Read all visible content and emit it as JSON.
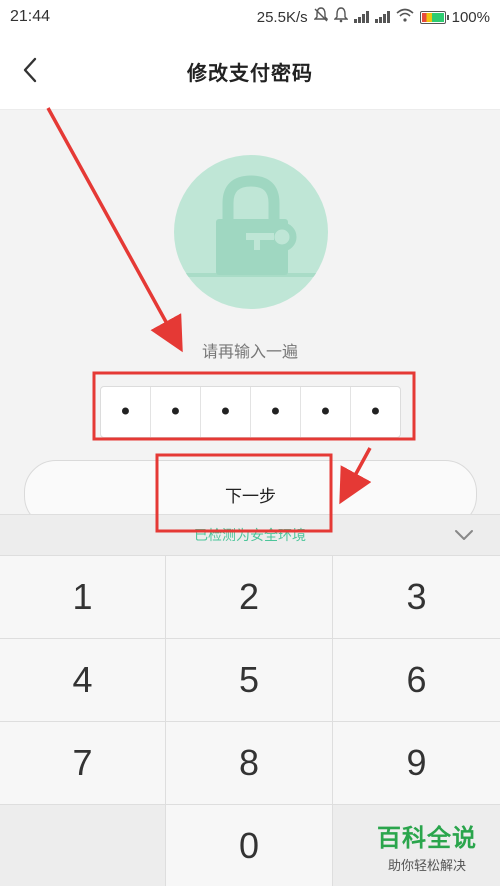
{
  "status_bar": {
    "time": "21:44",
    "network_speed": "25.5K/s",
    "battery": "100%",
    "icons": [
      "alarm-off-icon",
      "notification-bell-icon",
      "signal-icon",
      "signal-icon",
      "wifi-icon",
      "battery-icon"
    ]
  },
  "header": {
    "title": "修改支付密码",
    "back_icon": "chevron-left-icon"
  },
  "lock": {
    "icon": "lock-key-icon",
    "circle_color": "#bfe6d6",
    "icon_color": "#9fd7c1"
  },
  "password": {
    "instruction": "请再输入一遍",
    "digits": [
      "•",
      "•",
      "•",
      "•",
      "•",
      "•"
    ]
  },
  "next_button": {
    "label": "下一步"
  },
  "keyboard": {
    "secure_text": "已检测为安全环境",
    "collapse_icon": "chevron-down-icon",
    "keys": [
      "1",
      "2",
      "3",
      "4",
      "5",
      "6",
      "7",
      "8",
      "9",
      "",
      "0",
      ""
    ]
  },
  "watermark": {
    "main": "百科全说",
    "sub": "助你轻松解决"
  },
  "colors": {
    "accent_green": "#4cc59a",
    "annotation_red": "#e53935",
    "watermark_green": "#2aa54c"
  }
}
